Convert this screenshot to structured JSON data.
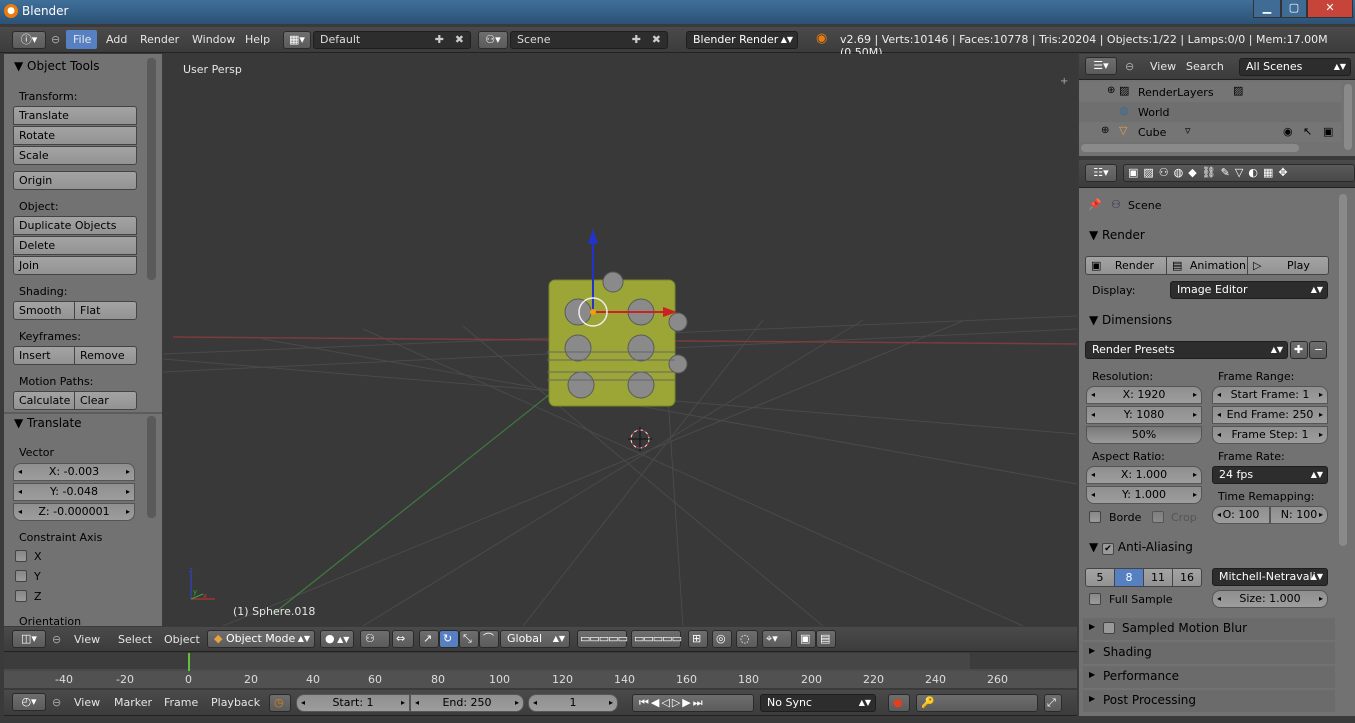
{
  "window": {
    "title": "Blender",
    "minimize": "▁",
    "maximize": "▢",
    "close": "✕"
  },
  "info_header": {
    "menus": [
      "File",
      "Add",
      "Render",
      "Window",
      "Help"
    ],
    "layout": "Default",
    "scene": "Scene",
    "engine": "Blender Render",
    "stats": "v2.69 | Verts:10146 | Faces:10778 | Tris:20204 | Objects:1/22 | Lamps:0/0 | Mem:17.00M (0.50M)"
  },
  "tool_shelf": {
    "title": "Object Tools",
    "transform_label": "Transform:",
    "translate": "Translate",
    "rotate": "Rotate",
    "scale": "Scale",
    "origin": "Origin",
    "object_label": "Object:",
    "duplicate": "Duplicate Objects",
    "delete": "Delete",
    "join": "Join",
    "shading_label": "Shading:",
    "smooth": "Smooth",
    "flat": "Flat",
    "keyframes_label": "Keyframes:",
    "insert": "Insert",
    "remove": "Remove",
    "motion_label": "Motion Paths:",
    "calculate": "Calculate",
    "clear": "Clear"
  },
  "operator_panel": {
    "title": "Translate",
    "vector_label": "Vector",
    "x": "X: -0.003",
    "y": "Y: -0.048",
    "z": "Z: -0.000001",
    "constraint_label": "Constraint Axis",
    "axes": [
      "X",
      "Y",
      "Z"
    ],
    "orientation_label": "Orientation"
  },
  "viewport": {
    "view_name": "User Persp",
    "object_name": "(1) Sphere.018",
    "axis_z": "z",
    "axis_y": "y",
    "axis_x": "x"
  },
  "view3d_header": {
    "menus": [
      "View",
      "Select",
      "Object"
    ],
    "mode": "Object Mode",
    "orientation": "Global"
  },
  "timeline": {
    "ticks": [
      "-40",
      "-20",
      "0",
      "20",
      "40",
      "60",
      "80",
      "100",
      "120",
      "140",
      "160",
      "180",
      "200",
      "220",
      "240",
      "260"
    ],
    "menus": [
      "View",
      "Marker",
      "Frame",
      "Playback"
    ],
    "start": "Start: 1",
    "end": "End: 250",
    "current": "1",
    "sync": "No Sync"
  },
  "outliner": {
    "menus": [
      "View",
      "Search"
    ],
    "scenes": "All Scenes",
    "items": [
      "RenderLayers",
      "World",
      "Cube"
    ]
  },
  "properties": {
    "context": "Scene",
    "render_panel": {
      "title": "Render",
      "render": "Render",
      "animation": "Animation",
      "play": "Play",
      "display_label": "Display:",
      "display": "Image Editor"
    },
    "dimensions": {
      "title": "Dimensions",
      "presets": "Render Presets",
      "resolution_label": "Resolution:",
      "res_x": "X: 1920",
      "res_y": "Y: 1080",
      "res_pct": "50%",
      "frame_range_label": "Frame Range:",
      "start": "Start Frame: 1",
      "end": "End Frame: 250",
      "step": "Frame Step: 1",
      "aspect_label": "Aspect Ratio:",
      "asp_x": "X: 1.000",
      "asp_y": "Y: 1.000",
      "frame_rate_label": "Frame Rate:",
      "fps": "24 fps",
      "remap_label": "Time Remapping:",
      "old": "O: 100",
      "new": "N: 100",
      "border": "Borde",
      "crop": "Crop"
    },
    "aa": {
      "title": "Anti-Aliasing",
      "samples": [
        "5",
        "8",
        "11",
        "16"
      ],
      "filter": "Mitchell-Netravali",
      "full_sample": "Full Sample",
      "size": "Size: 1.000"
    },
    "collapsed": [
      "Sampled Motion Blur",
      "Shading",
      "Performance",
      "Post Processing"
    ]
  },
  "colors": {
    "accent": "#5680c2",
    "orange": "#e87d0d"
  }
}
